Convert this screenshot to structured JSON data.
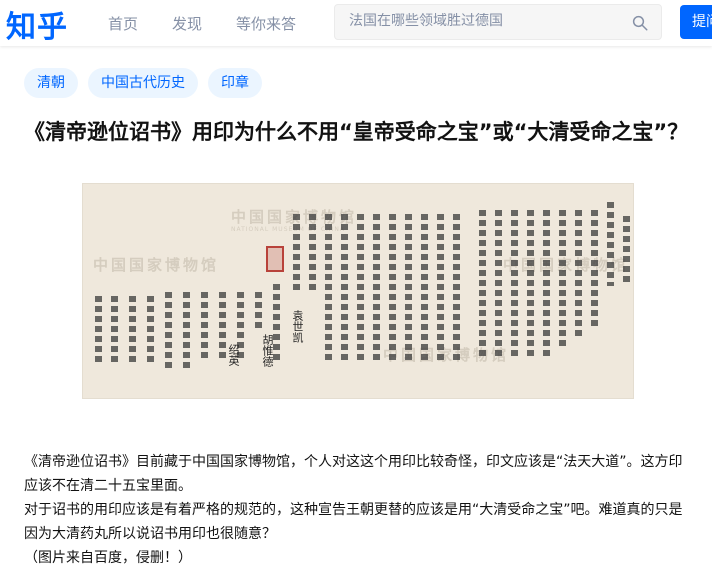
{
  "header": {
    "logo": "知乎",
    "nav": [
      "首页",
      "发现",
      "等你来答"
    ],
    "search_placeholder": "法国在哪些领域胜过德国",
    "ask_label": "提问"
  },
  "tags": [
    "清朝",
    "中国古代历史",
    "印章"
  ],
  "title": "《清帝逊位诏书》用印为什么不用“皇帝受命之宝”或“大清受命之宝”？",
  "image": {
    "watermark": "中国国家博物馆",
    "watermark_en": "NATIONAL MUSEUM OF CHINA",
    "signatures": [
      "胡惟德",
      "绍英",
      "袁世凯"
    ]
  },
  "content": {
    "p1": "《清帝逊位诏书》目前藏于中国国家博物馆，个人对这这个用印比较奇怪，印文应该是“法天大道”。这方印应该不在清二十五宝里面。",
    "p2": "对于诏书的用印应该是有着严格的规范的，这种宣告王朝更替的应该是用“大清受命之宝”吧。难道真的只是因为大清药丸所以说诏书用印也很随意？",
    "p3": "（图片来自百度，侵删！）"
  },
  "colors": {
    "brand": "#0066ff",
    "tag_bg": "#ebf5ff",
    "seal": "#b8423a"
  }
}
